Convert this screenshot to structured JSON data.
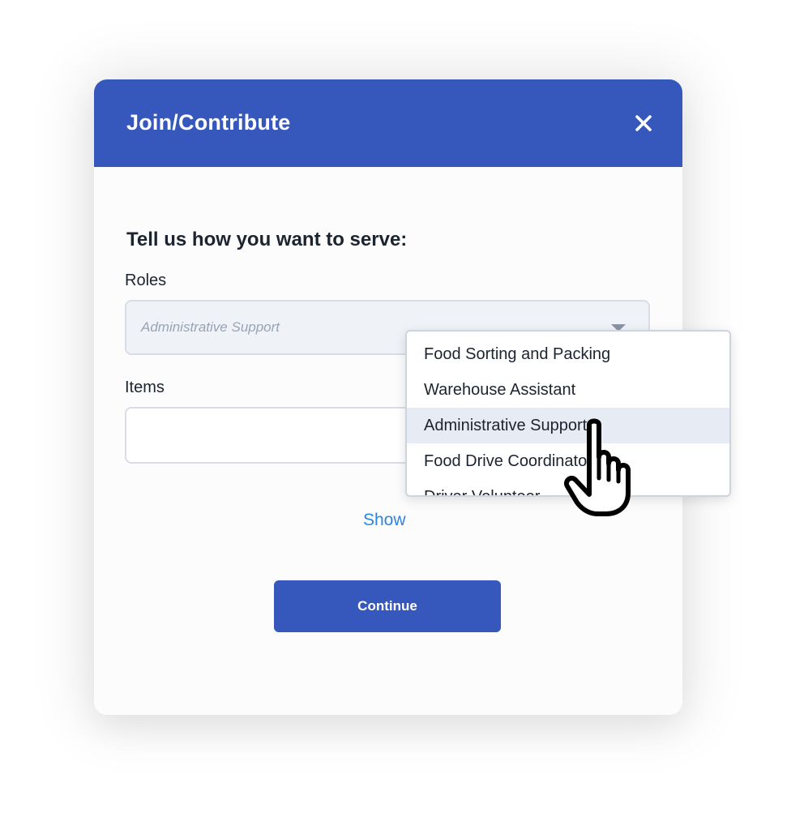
{
  "modal": {
    "title": "Join/Contribute",
    "close_icon": "close-icon",
    "section_title": "Tell us how you want to serve:",
    "roles_label": "Roles",
    "roles_value": "Administrative Support",
    "items_label": "Items",
    "items_value": "",
    "show_link": "Show",
    "continue_label": "Continue"
  },
  "dropdown": {
    "options": [
      "Food Sorting and Packing",
      "Warehouse Assistant",
      "Administrative Support",
      "Food Drive Coordinator",
      "Driver Volunteer"
    ],
    "selected": "Administrative Support"
  },
  "colors": {
    "header": "#3658bd",
    "button": "#3658bd",
    "link": "#2a86e0",
    "text": "#1c2430",
    "selected_option": "#e7ecf4"
  }
}
